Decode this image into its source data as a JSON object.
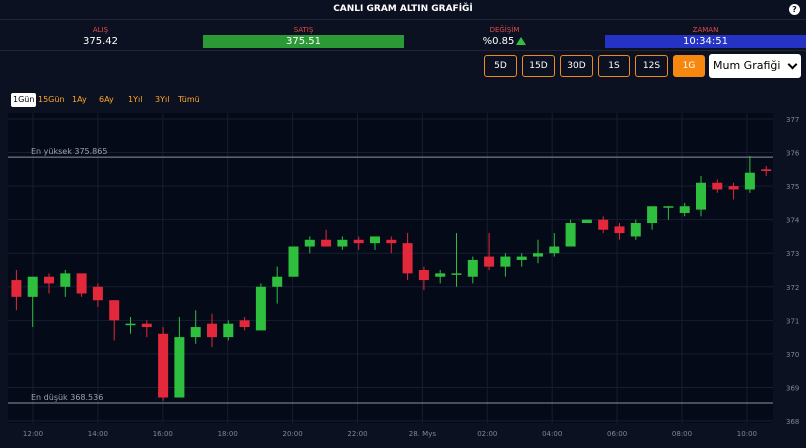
{
  "title": "CANLI GRAM ALTIN GRAFİĞİ",
  "help_icon": "question-icon",
  "ticker": {
    "bid_label": "ALIŞ",
    "bid_value": "375.42",
    "ask_label": "SATIŞ",
    "ask_value": "375.51",
    "change_label": "DEĞİŞİM",
    "change_value": "%0.85",
    "time_label": "ZAMAN",
    "time_value": "10:34:51"
  },
  "colors": {
    "up": "#2fbf3f",
    "down": "#e3283c",
    "accent": "#f7870f",
    "label_red": "#e04a4a",
    "ask_bg": "#2b9a36",
    "time_bg": "#2433c4"
  },
  "range_buttons": [
    {
      "label": "5D",
      "active": false
    },
    {
      "label": "15D",
      "active": false
    },
    {
      "label": "30D",
      "active": false
    },
    {
      "label": "1S",
      "active": false
    },
    {
      "label": "12S",
      "active": false
    },
    {
      "label": "1G",
      "active": true
    }
  ],
  "chart_type_select": "Mum Grafiği",
  "periods": [
    {
      "label": "1Gün",
      "active": true
    },
    {
      "label": "15Gün",
      "active": false
    },
    {
      "label": "1Ay",
      "active": false
    },
    {
      "label": "6Ay",
      "active": false
    },
    {
      "label": "1Yıl",
      "active": false
    },
    {
      "label": "3Yıl",
      "active": false
    },
    {
      "label": "Tümü",
      "active": false
    }
  ],
  "chart_data": {
    "type": "candlestick",
    "ylim": [
      368,
      377
    ],
    "yticks": [
      "368",
      "369",
      "370",
      "371",
      "372",
      "373",
      "374",
      "375",
      "376",
      "377"
    ],
    "xticks": [
      "12:00",
      "14:00",
      "16:00",
      "18:00",
      "20:00",
      "22:00",
      "28. Mys",
      "02:00",
      "04:00",
      "06:00",
      "08:00",
      "10:00"
    ],
    "high_label": "En yüksek 375.865",
    "high": 375.865,
    "low_label": "En düşük 368.536",
    "low": 368.536,
    "grid": true,
    "candles": [
      {
        "t": 0,
        "o": 372.2,
        "h": 372.5,
        "l": 371.3,
        "c": 371.7
      },
      {
        "t": 1,
        "o": 371.7,
        "h": 372.3,
        "l": 370.8,
        "c": 372.3
      },
      {
        "t": 2,
        "o": 372.3,
        "h": 372.4,
        "l": 371.8,
        "c": 372.1
      },
      {
        "t": 3,
        "o": 372.0,
        "h": 372.5,
        "l": 371.7,
        "c": 372.4
      },
      {
        "t": 4,
        "o": 372.4,
        "h": 372.4,
        "l": 371.7,
        "c": 371.8
      },
      {
        "t": 5,
        "o": 372.0,
        "h": 372.1,
        "l": 371.4,
        "c": 371.6
      },
      {
        "t": 6,
        "o": 371.6,
        "h": 371.6,
        "l": 370.4,
        "c": 371.0
      },
      {
        "t": 7,
        "o": 370.9,
        "h": 371.1,
        "l": 370.6,
        "c": 370.9
      },
      {
        "t": 8,
        "o": 370.9,
        "h": 371.0,
        "l": 370.5,
        "c": 370.8
      },
      {
        "t": 9,
        "o": 370.6,
        "h": 370.8,
        "l": 368.6,
        "c": 368.7
      },
      {
        "t": 10,
        "o": 368.7,
        "h": 371.1,
        "l": 368.7,
        "c": 370.5
      },
      {
        "t": 11,
        "o": 370.5,
        "h": 371.3,
        "l": 370.3,
        "c": 370.8
      },
      {
        "t": 12,
        "o": 370.9,
        "h": 371.2,
        "l": 370.2,
        "c": 370.5
      },
      {
        "t": 13,
        "o": 370.5,
        "h": 371.0,
        "l": 370.4,
        "c": 370.9
      },
      {
        "t": 14,
        "o": 371.0,
        "h": 371.1,
        "l": 370.7,
        "c": 370.8
      },
      {
        "t": 15,
        "o": 370.7,
        "h": 372.1,
        "l": 370.7,
        "c": 372.0
      },
      {
        "t": 16,
        "o": 372.0,
        "h": 372.6,
        "l": 371.5,
        "c": 372.3
      },
      {
        "t": 17,
        "o": 372.3,
        "h": 373.2,
        "l": 372.3,
        "c": 373.2
      },
      {
        "t": 18,
        "o": 373.2,
        "h": 373.5,
        "l": 373.0,
        "c": 373.4
      },
      {
        "t": 19,
        "o": 373.4,
        "h": 373.7,
        "l": 373.2,
        "c": 373.2
      },
      {
        "t": 20,
        "o": 373.2,
        "h": 373.5,
        "l": 373.1,
        "c": 373.4
      },
      {
        "t": 21,
        "o": 373.4,
        "h": 373.5,
        "l": 373.1,
        "c": 373.3
      },
      {
        "t": 22,
        "o": 373.3,
        "h": 373.5,
        "l": 373.1,
        "c": 373.5
      },
      {
        "t": 23,
        "o": 373.4,
        "h": 373.5,
        "l": 373.0,
        "c": 373.3
      },
      {
        "t": 24,
        "o": 373.3,
        "h": 373.6,
        "l": 372.2,
        "c": 372.4
      },
      {
        "t": 25,
        "o": 372.5,
        "h": 372.6,
        "l": 371.9,
        "c": 372.2
      },
      {
        "t": 26,
        "o": 372.3,
        "h": 372.5,
        "l": 372.1,
        "c": 372.4
      },
      {
        "t": 27,
        "o": 372.4,
        "h": 373.6,
        "l": 372.0,
        "c": 372.4
      },
      {
        "t": 28,
        "o": 372.3,
        "h": 372.9,
        "l": 372.1,
        "c": 372.8
      },
      {
        "t": 29,
        "o": 372.9,
        "h": 373.6,
        "l": 372.5,
        "c": 372.6
      },
      {
        "t": 30,
        "o": 372.6,
        "h": 373.0,
        "l": 372.3,
        "c": 372.9
      },
      {
        "t": 31,
        "o": 372.8,
        "h": 373.0,
        "l": 372.6,
        "c": 372.9
      },
      {
        "t": 32,
        "o": 372.9,
        "h": 373.4,
        "l": 372.7,
        "c": 373.0
      },
      {
        "t": 33,
        "o": 373.0,
        "h": 373.6,
        "l": 372.9,
        "c": 373.2
      },
      {
        "t": 34,
        "o": 373.2,
        "h": 374.0,
        "l": 373.2,
        "c": 373.9
      },
      {
        "t": 35,
        "o": 373.9,
        "h": 374.0,
        "l": 373.9,
        "c": 374.0
      },
      {
        "t": 36,
        "o": 374.0,
        "h": 374.1,
        "l": 373.6,
        "c": 373.7
      },
      {
        "t": 37,
        "o": 373.8,
        "h": 373.9,
        "l": 373.4,
        "c": 373.6
      },
      {
        "t": 38,
        "o": 373.5,
        "h": 374.0,
        "l": 373.4,
        "c": 373.9
      },
      {
        "t": 39,
        "o": 373.9,
        "h": 374.4,
        "l": 373.7,
        "c": 374.4
      },
      {
        "t": 40,
        "o": 374.4,
        "h": 374.4,
        "l": 374.0,
        "c": 374.4
      },
      {
        "t": 41,
        "o": 374.2,
        "h": 374.5,
        "l": 374.1,
        "c": 374.4
      },
      {
        "t": 42,
        "o": 374.3,
        "h": 375.3,
        "l": 374.1,
        "c": 375.1
      },
      {
        "t": 43,
        "o": 375.1,
        "h": 375.2,
        "l": 374.8,
        "c": 374.9
      },
      {
        "t": 44,
        "o": 375.0,
        "h": 375.1,
        "l": 374.6,
        "c": 374.9
      },
      {
        "t": 45,
        "o": 374.9,
        "h": 375.9,
        "l": 374.8,
        "c": 375.4
      },
      {
        "t": 46,
        "o": 375.5,
        "h": 375.6,
        "l": 375.3,
        "c": 375.45
      }
    ]
  }
}
